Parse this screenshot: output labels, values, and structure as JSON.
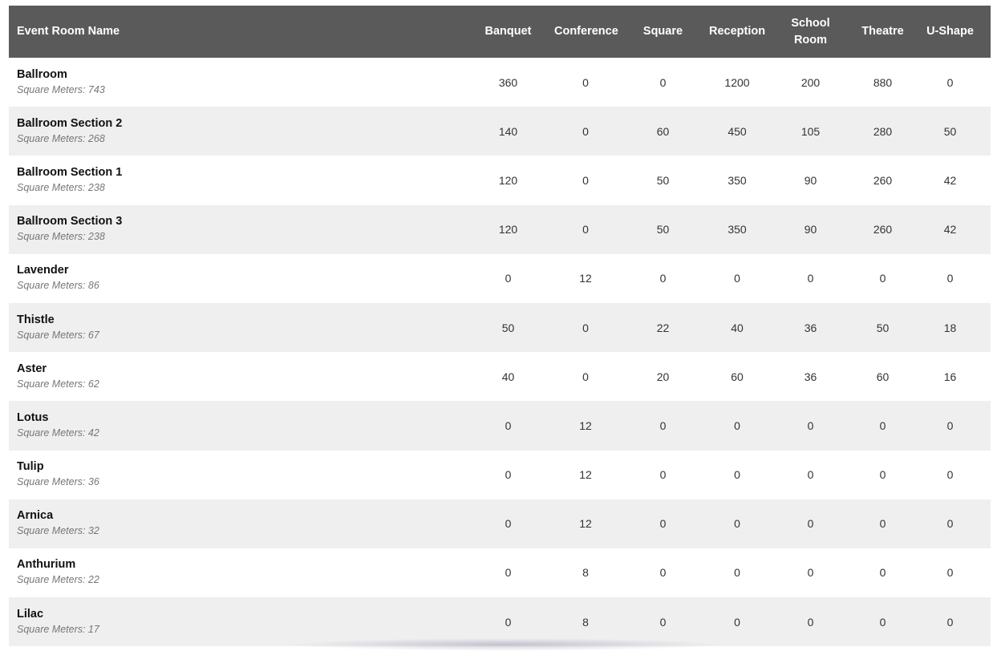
{
  "table": {
    "headers": [
      [
        "Event Room Name"
      ],
      [
        "Banquet"
      ],
      [
        "Conference"
      ],
      [
        "Square"
      ],
      [
        "Reception"
      ],
      [
        "School",
        "Room"
      ],
      [
        "Theatre"
      ],
      [
        "U-Shape"
      ]
    ],
    "rows": [
      {
        "name": "Ballroom",
        "area": "Square Meters: 743",
        "values": [
          "360",
          "0",
          "0",
          "1200",
          "200",
          "880",
          "0"
        ]
      },
      {
        "name": "Ballroom Section 2",
        "area": "Square Meters: 268",
        "values": [
          "140",
          "0",
          "60",
          "450",
          "105",
          "280",
          "50"
        ]
      },
      {
        "name": "Ballroom Section 1",
        "area": "Square Meters: 238",
        "values": [
          "120",
          "0",
          "50",
          "350",
          "90",
          "260",
          "42"
        ]
      },
      {
        "name": "Ballroom Section 3",
        "area": "Square Meters: 238",
        "values": [
          "120",
          "0",
          "50",
          "350",
          "90",
          "260",
          "42"
        ]
      },
      {
        "name": "Lavender",
        "area": "Square Meters: 86",
        "values": [
          "0",
          "12",
          "0",
          "0",
          "0",
          "0",
          "0"
        ]
      },
      {
        "name": "Thistle",
        "area": "Square Meters: 67",
        "values": [
          "50",
          "0",
          "22",
          "40",
          "36",
          "50",
          "18"
        ]
      },
      {
        "name": "Aster",
        "area": "Square Meters: 62",
        "values": [
          "40",
          "0",
          "20",
          "60",
          "36",
          "60",
          "16"
        ]
      },
      {
        "name": "Lotus",
        "area": "Square Meters: 42",
        "values": [
          "0",
          "12",
          "0",
          "0",
          "0",
          "0",
          "0"
        ]
      },
      {
        "name": "Tulip",
        "area": "Square Meters: 36",
        "values": [
          "0",
          "12",
          "0",
          "0",
          "0",
          "0",
          "0"
        ]
      },
      {
        "name": "Arnica",
        "area": "Square Meters: 32",
        "values": [
          "0",
          "12",
          "0",
          "0",
          "0",
          "0",
          "0"
        ]
      },
      {
        "name": "Anthurium",
        "area": "Square Meters: 22",
        "values": [
          "0",
          "8",
          "0",
          "0",
          "0",
          "0",
          "0"
        ]
      },
      {
        "name": "Lilac",
        "area": "Square Meters: 17",
        "values": [
          "0",
          "8",
          "0",
          "0",
          "0",
          "0",
          "0"
        ]
      }
    ]
  },
  "colors": {
    "header_bg": "#5a5a5a",
    "header_text": "#ffffff",
    "row_alt_bg": "#efefef",
    "row_bg": "#ffffff"
  }
}
